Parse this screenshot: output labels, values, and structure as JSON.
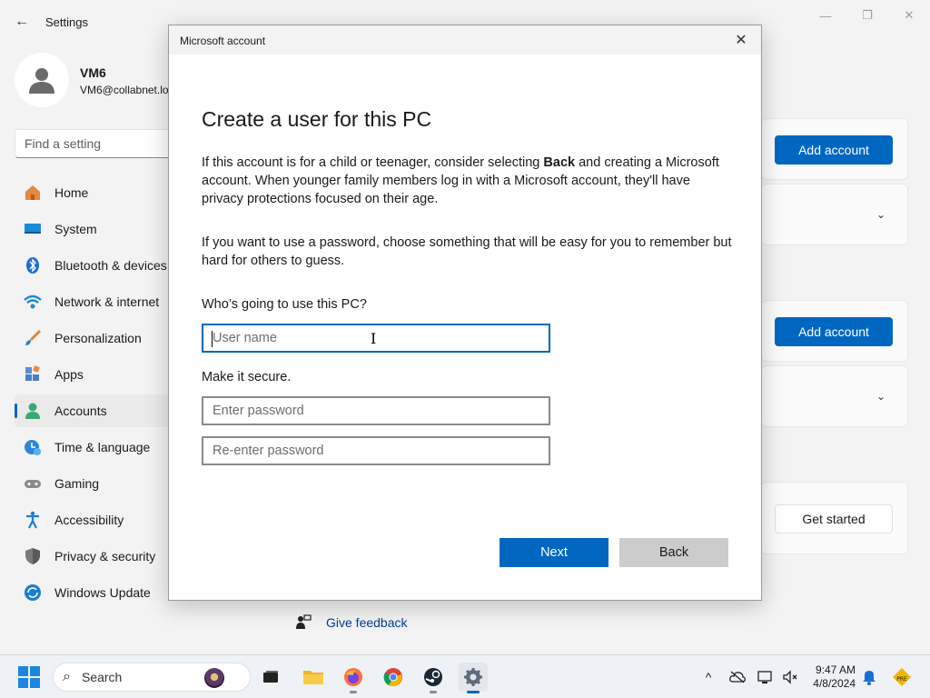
{
  "window": {
    "title": "Settings",
    "controls": {
      "minimize": "—",
      "maximize": "❐",
      "close": "✕"
    }
  },
  "profile": {
    "name": "VM6",
    "email": "VM6@collabnet.lo"
  },
  "search": {
    "placeholder": "Find a setting"
  },
  "nav": [
    {
      "label": "Home",
      "icon": "home-icon",
      "active": false
    },
    {
      "label": "System",
      "icon": "system-icon",
      "active": false
    },
    {
      "label": "Bluetooth & devices",
      "icon": "bluetooth-icon",
      "active": false
    },
    {
      "label": "Network & internet",
      "icon": "network-icon",
      "active": false
    },
    {
      "label": "Personalization",
      "icon": "brush-icon",
      "active": false
    },
    {
      "label": "Apps",
      "icon": "apps-icon",
      "active": false
    },
    {
      "label": "Accounts",
      "icon": "accounts-icon",
      "active": true
    },
    {
      "label": "Time & language",
      "icon": "time-icon",
      "active": false
    },
    {
      "label": "Gaming",
      "icon": "gaming-icon",
      "active": false
    },
    {
      "label": "Accessibility",
      "icon": "accessibility-icon",
      "active": false
    },
    {
      "label": "Privacy & security",
      "icon": "shield-icon",
      "active": false
    },
    {
      "label": "Windows Update",
      "icon": "update-icon",
      "active": false
    }
  ],
  "background_cards": {
    "add_account_1": "Add account",
    "add_account_2": "Add account",
    "get_started": "Get started"
  },
  "feedback": {
    "label": "Give feedback"
  },
  "dialog": {
    "title": "Microsoft account",
    "heading": "Create a user for this PC",
    "para1_a": "If this account is for a child or teenager, consider selecting ",
    "para1_bold": "Back",
    "para1_b": " and creating a Microsoft account. When younger family members log in with a Microsoft account, they'll have privacy protections focused on their age.",
    "para2": "If you want to use a password, choose something that will be easy for you to remember but hard for others to guess.",
    "who_label": "Who’s going to use this PC?",
    "username_placeholder": "User name",
    "secure_label": "Make it secure.",
    "password_placeholder": "Enter password",
    "reenter_placeholder": "Re-enter password",
    "next_label": "Next",
    "back_label": "Back"
  },
  "taskbar": {
    "search_label": "Search",
    "time": "9:47 AM",
    "date": "4/8/2024",
    "apps": [
      "task-view",
      "file-explorer",
      "firefox",
      "chrome",
      "steam",
      "settings"
    ]
  },
  "colors": {
    "accent": "#0067c0",
    "back_button": "#cccccc"
  }
}
